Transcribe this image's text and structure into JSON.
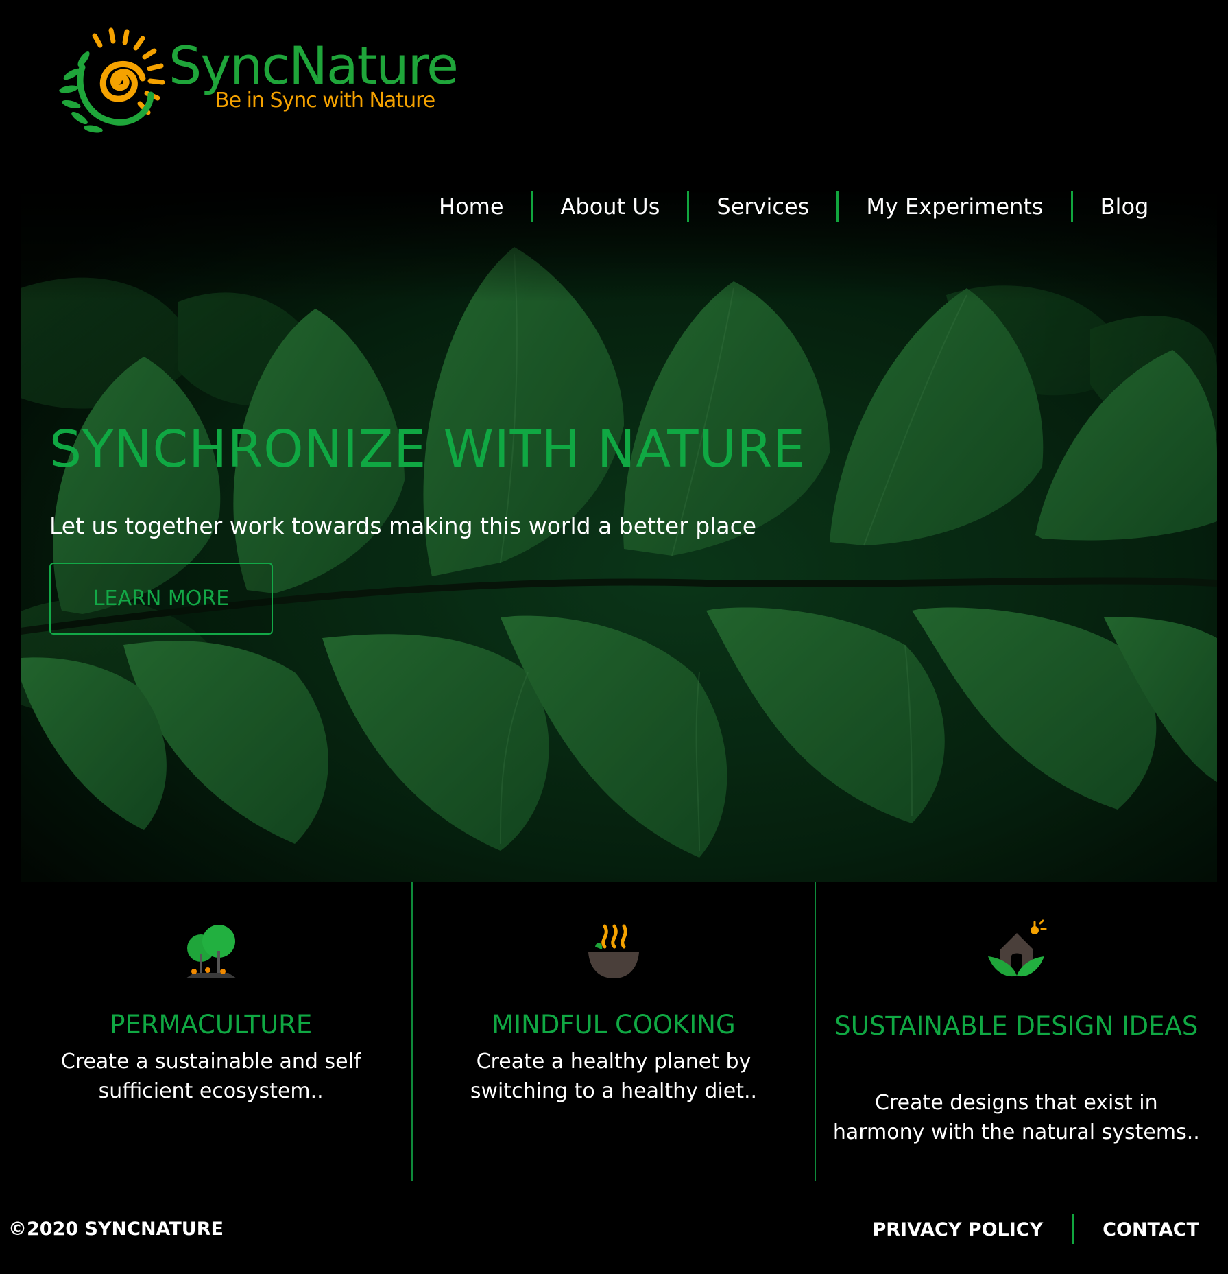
{
  "brand": {
    "name": "SyncNature",
    "tagline": "Be in Sync with Nature"
  },
  "nav": {
    "items": [
      {
        "label": "Home"
      },
      {
        "label": "About Us"
      },
      {
        "label": "Services"
      },
      {
        "label": "My Experiments"
      },
      {
        "label": "Blog"
      }
    ]
  },
  "hero": {
    "title": "SYNCHRONIZE WITH NATURE",
    "subtitle": "Let us together work towards making this world a better place",
    "button_label": "LEARN MORE",
    "image": "green-fern-leaves"
  },
  "cards": [
    {
      "icon": "trees-icon",
      "title": "PERMACULTURE",
      "description": "Create a sustainable and self sufficient ecosystem.."
    },
    {
      "icon": "cooking-bowl-icon",
      "title": "MINDFUL COOKING",
      "description": "Create a healthy planet by switching to a healthy diet.."
    },
    {
      "icon": "eco-house-icon",
      "title": "SUSTAINABLE DESIGN IDEAS",
      "description": "Create designs that exist in harmony with the natural systems.."
    }
  ],
  "footer": {
    "copyright": "©2020 SYNCNATURE",
    "links": [
      {
        "label": "PRIVACY POLICY"
      },
      {
        "label": "CONTACT"
      }
    ]
  },
  "colors": {
    "accent_green": "#10a843",
    "logo_orange": "#f5a200",
    "background": "#000000",
    "text": "#ffffff"
  }
}
